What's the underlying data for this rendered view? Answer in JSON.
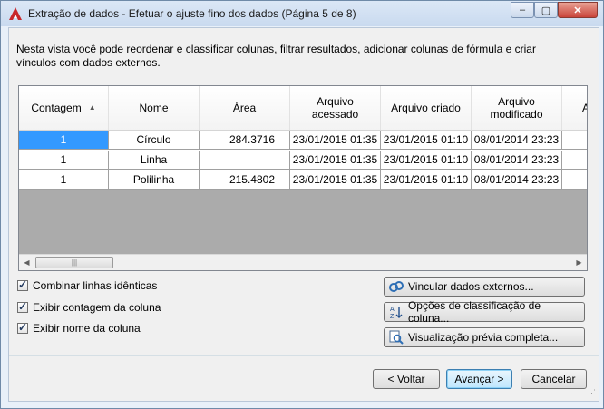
{
  "window": {
    "title": "Extração de dados - Efetuar o ajuste fino dos dados (Página 5 de 8)",
    "controls": {
      "minimize": "–",
      "maximize": "▢",
      "close": "✕"
    }
  },
  "description": "Nesta vista você pode reordenar e classificar colunas, filtrar resultados, adicionar colunas de fórmula e criar vínculos com dados externos.",
  "table": {
    "headers": [
      "Contagem",
      "Nome",
      "Área",
      "Arquivo acessado",
      "Arquivo criado",
      "Arquivo modificado",
      "A"
    ],
    "rows": [
      [
        "1",
        "Círculo",
        "284.3716",
        "23/01/2015 01:35",
        "23/01/2015 01:10",
        "08/01/2014 23:23"
      ],
      [
        "1",
        "Linha",
        "",
        "23/01/2015 01:35",
        "23/01/2015 01:10",
        "08/01/2014 23:23"
      ],
      [
        "1",
        "Polilinha",
        "215.4802",
        "23/01/2015 01:35",
        "23/01/2015 01:10",
        "08/01/2014 23:23"
      ]
    ]
  },
  "options": {
    "combine": "Combinar linhas idênticas",
    "show_count": "Exibir contagem da coluna",
    "show_name": "Exibir nome da coluna"
  },
  "side_buttons": {
    "link": "Vincular dados externos...",
    "sort": "Opções de classificação de coluna...",
    "preview": "Visualização prévia completa..."
  },
  "footer": {
    "back": "< Voltar",
    "next": "Avançar >",
    "cancel": "Cancelar"
  },
  "colors": {
    "accent": "#3399ff",
    "grid_bg": "#ababab",
    "brand": "#c8282c"
  }
}
